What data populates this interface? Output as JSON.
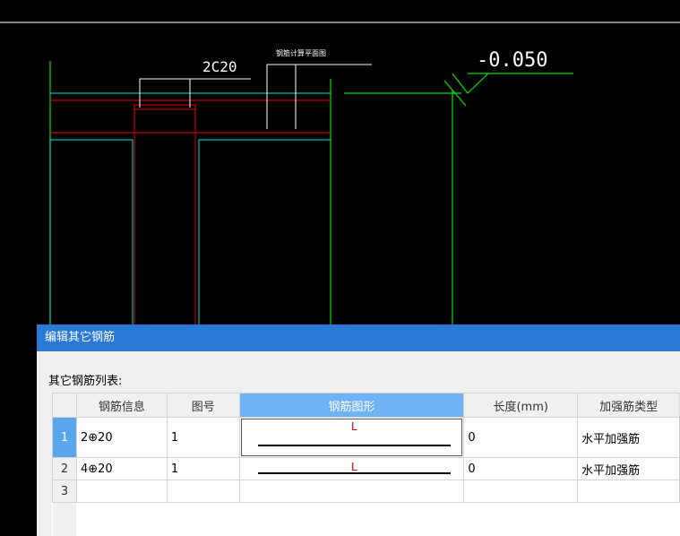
{
  "drawing": {
    "label_rebar": "2C20",
    "label_small": "钢筋计算平面图",
    "label_elev": "-0.050"
  },
  "dialog": {
    "title": "编辑其它钢筋",
    "list_label": "其它钢筋列表:",
    "columns": [
      "钢筋信息",
      "图号",
      "钢筋图形",
      "长度(mm)",
      "加强筋类型"
    ],
    "rows": [
      {
        "num": "1",
        "info": "2⊕20",
        "fig": "1",
        "shape": "L",
        "length": "0",
        "type": "水平加强筋"
      },
      {
        "num": "2",
        "info": "4⊕20",
        "fig": "1",
        "shape": "L",
        "length": "0",
        "type": "水平加强筋"
      },
      {
        "num": "3",
        "info": "",
        "fig": "",
        "shape": "",
        "length": "",
        "type": ""
      }
    ]
  }
}
